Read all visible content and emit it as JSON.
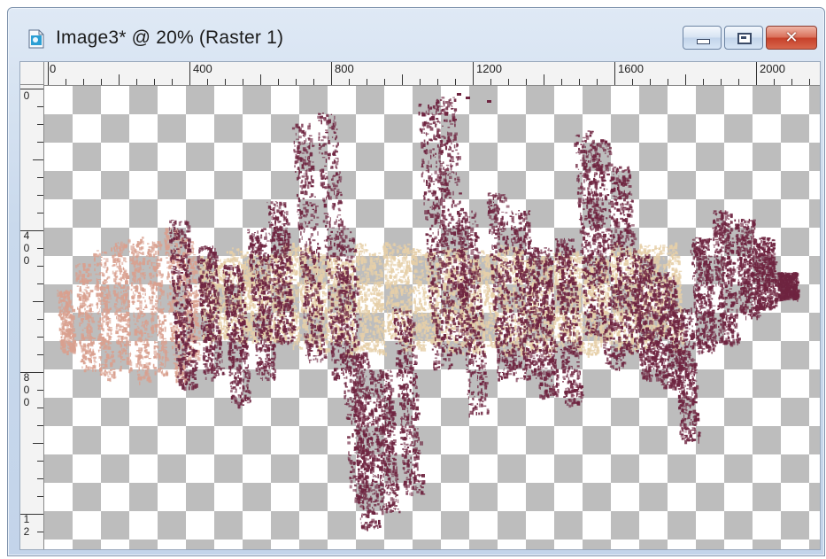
{
  "window": {
    "title": "Image3* @  20% (Raster 1)",
    "app_icon": "psp-image-icon",
    "buttons": {
      "minimize": "minimize-icon",
      "maximize": "maximize-icon",
      "close": "close-icon",
      "close_glyph": "✕"
    }
  },
  "ruler": {
    "horizontal_labels": [
      "0",
      "400",
      "800",
      "1200",
      "1600",
      "2000"
    ],
    "vertical_labels": [
      {
        "text": [
          "0"
        ]
      },
      {
        "text": [
          "4",
          "0",
          "0"
        ]
      },
      {
        "text": [
          "8",
          "0",
          "0"
        ]
      },
      {
        "text": [
          "1",
          "2"
        ]
      }
    ]
  },
  "canvas": {
    "zoom": "20%",
    "layer": "Raster 1",
    "background": "transparent-checkerboard",
    "colors": {
      "dark_strokes": "#6e2440",
      "light_strokes": "#e6cfa8",
      "pink_strokes": "#d9a08f"
    }
  }
}
